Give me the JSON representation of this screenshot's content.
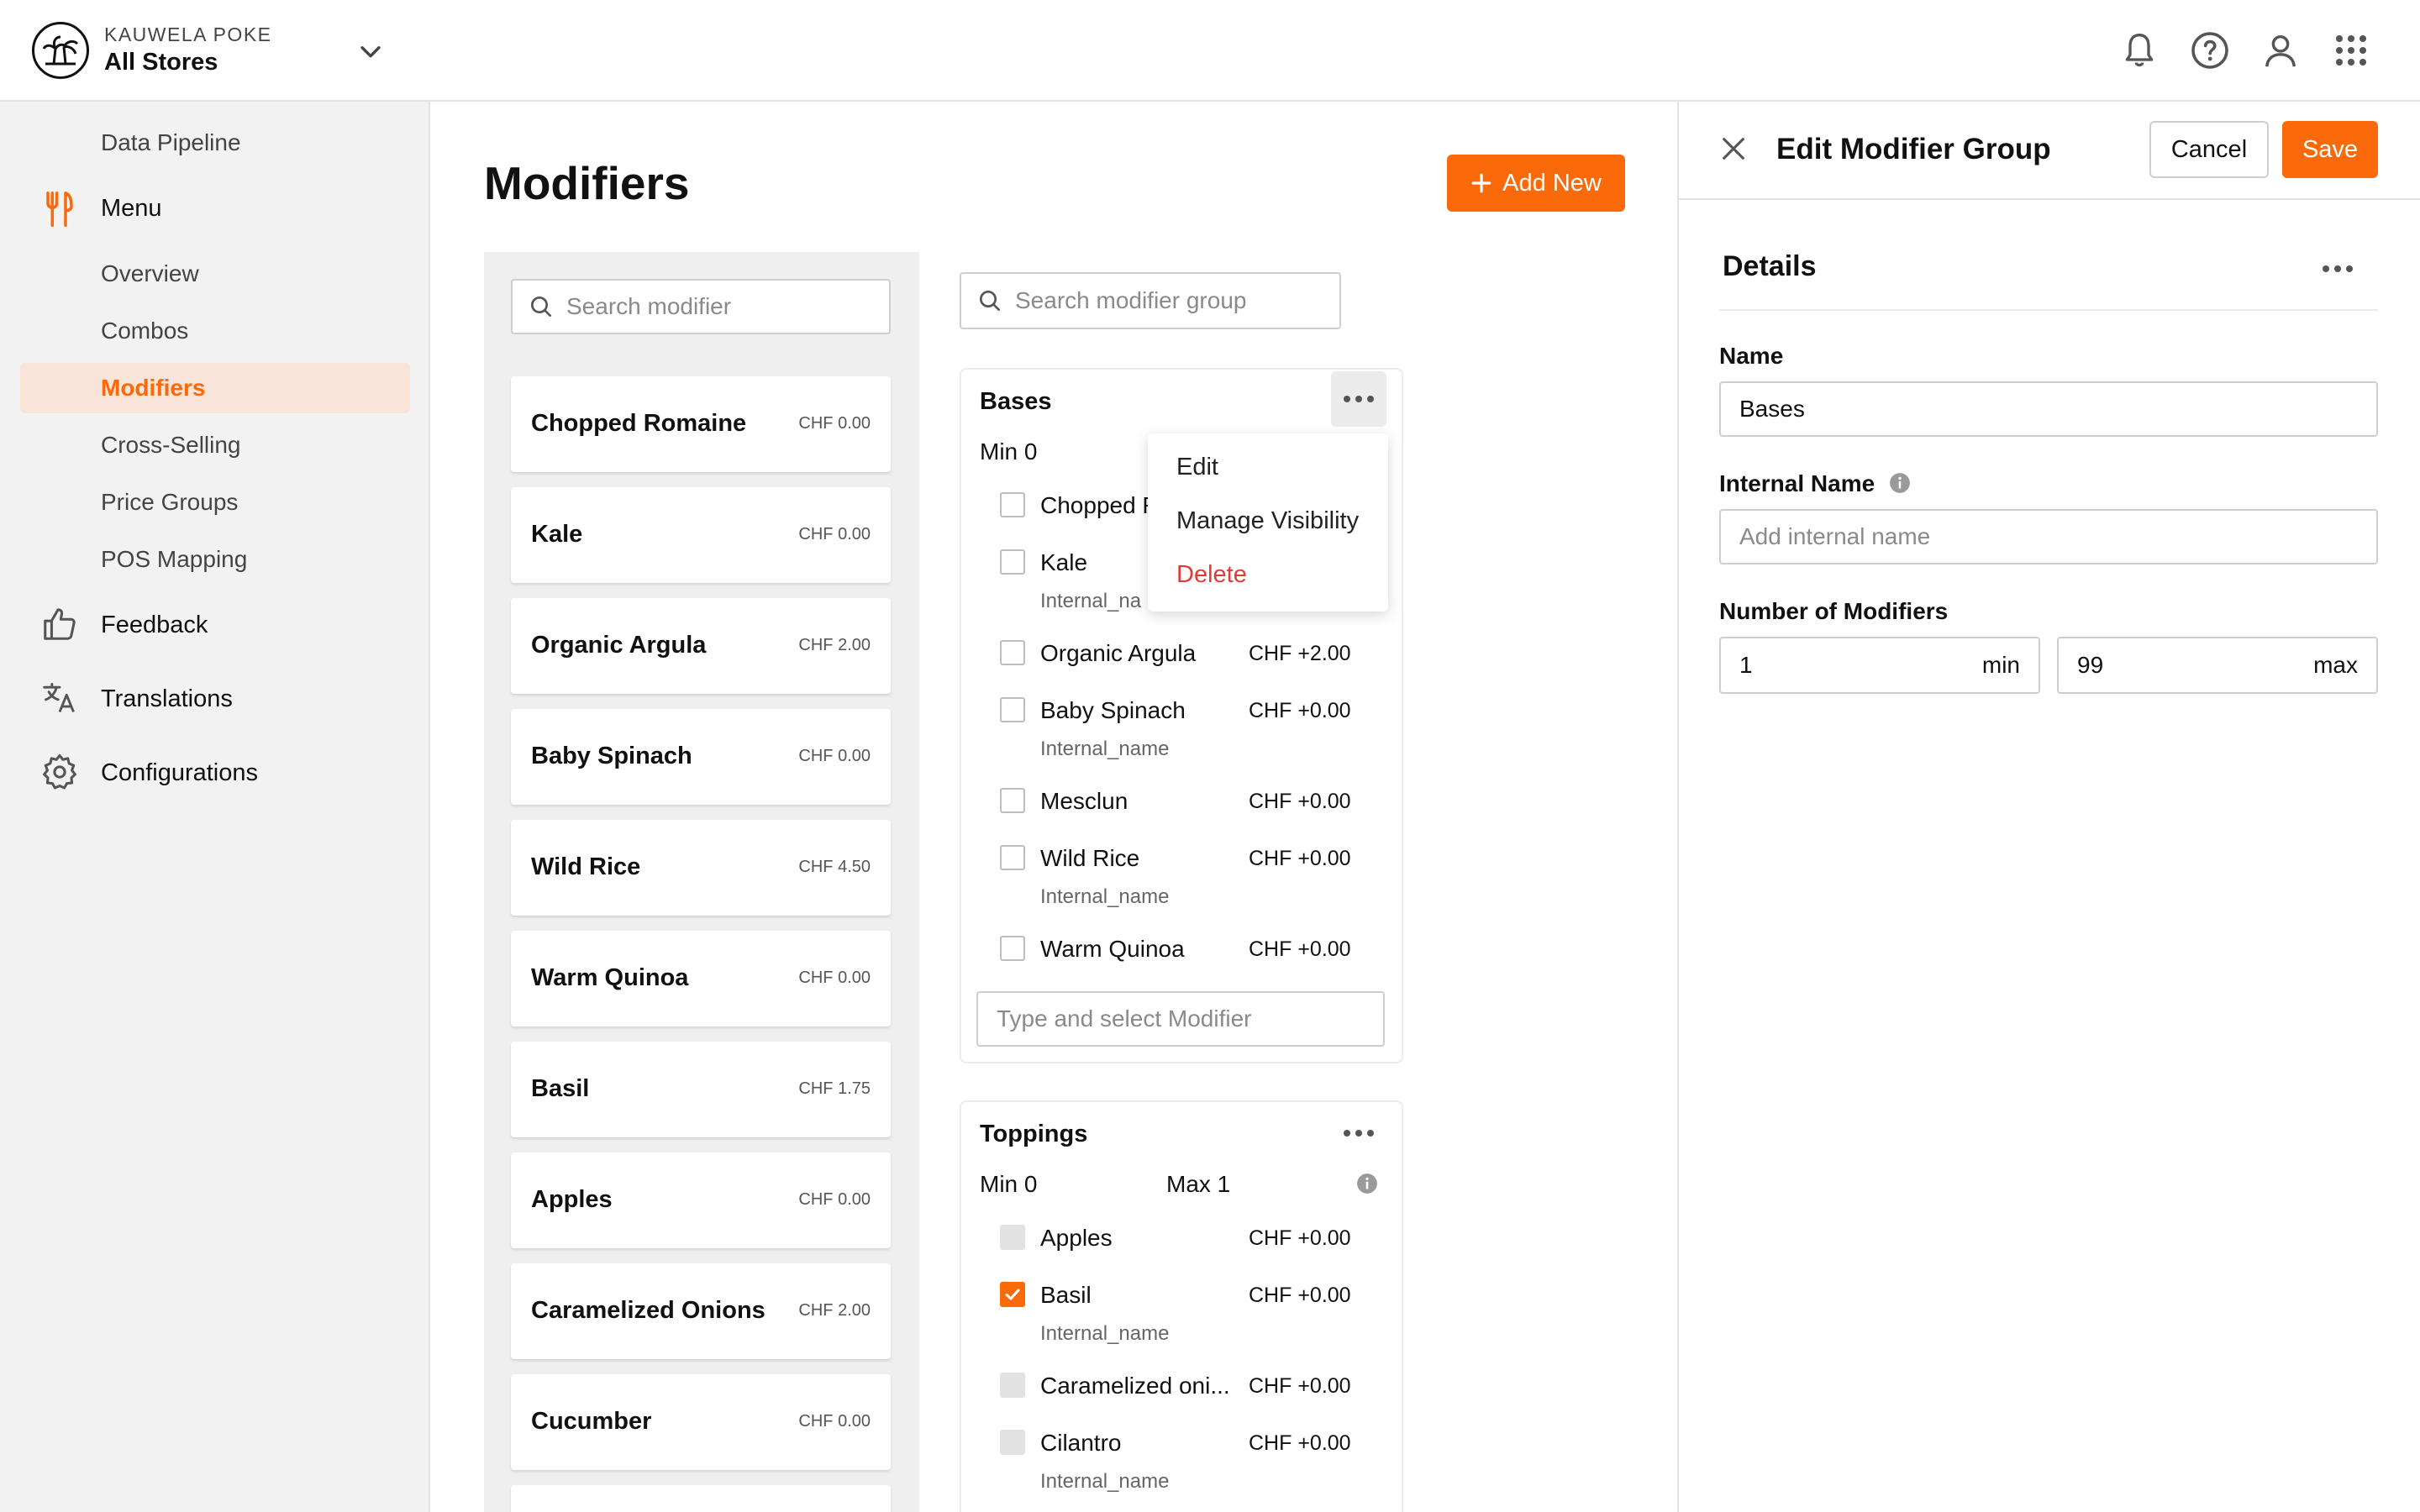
{
  "header": {
    "brand": "KAUWELA POKE",
    "store": "All Stores"
  },
  "sidebar": {
    "data_pipeline": "Data Pipeline",
    "menu": "Menu",
    "menu_items": [
      "Overview",
      "Combos",
      "Modifiers",
      "Cross-Selling",
      "Price Groups",
      "POS Mapping"
    ],
    "active_item": "Modifiers",
    "feedback": "Feedback",
    "translations": "Translations",
    "configurations": "Configurations"
  },
  "main": {
    "title": "Modifiers",
    "add_new": "Add New",
    "search_modifier_placeholder": "Search modifier",
    "search_group_placeholder": "Search modifier group",
    "modifiers": [
      {
        "name": "Chopped Romaine",
        "price": "CHF 0.00"
      },
      {
        "name": "Kale",
        "price": "CHF 0.00"
      },
      {
        "name": "Organic Argula",
        "price": "CHF 2.00"
      },
      {
        "name": "Baby Spinach",
        "price": "CHF 0.00"
      },
      {
        "name": "Wild Rice",
        "price": "CHF 4.50"
      },
      {
        "name": "Warm Quinoa",
        "price": "CHF 0.00"
      },
      {
        "name": "Basil",
        "price": "CHF 1.75"
      },
      {
        "name": "Apples",
        "price": "CHF 0.00"
      },
      {
        "name": "Caramelized Onions",
        "price": "CHF 2.00"
      },
      {
        "name": "Cucumber",
        "price": "CHF 0.00"
      }
    ],
    "groups": {
      "bases": {
        "title": "Bases",
        "min": "Min 0",
        "items": [
          {
            "name": "Chopped R",
            "price": "",
            "internal": ""
          },
          {
            "name": "Kale",
            "price": "",
            "internal": "Internal_na"
          },
          {
            "name": "Organic Argula",
            "price": "CHF +2.00",
            "internal": ""
          },
          {
            "name": "Baby Spinach",
            "price": "CHF +0.00",
            "internal": "Internal_name"
          },
          {
            "name": "Mesclun",
            "price": "CHF +0.00",
            "internal": ""
          },
          {
            "name": "Wild Rice",
            "price": "CHF +0.00",
            "internal": "Internal_name"
          },
          {
            "name": "Warm Quinoa",
            "price": "CHF +0.00",
            "internal": ""
          }
        ],
        "type_select_placeholder": "Type and select Modifier"
      },
      "toppings": {
        "title": "Toppings",
        "min": "Min 0",
        "max": "Max 1",
        "items": [
          {
            "name": "Apples",
            "price": "CHF +0.00",
            "internal": ""
          },
          {
            "name": "Basil",
            "price": "CHF +0.00",
            "internal": "Internal_name",
            "checked": true
          },
          {
            "name": "Caramelized oni...",
            "price": "CHF +0.00",
            "internal": ""
          },
          {
            "name": "Cilantro",
            "price": "CHF +0.00",
            "internal": "Internal_name"
          }
        ]
      }
    },
    "context_menu": {
      "edit": "Edit",
      "manage_visibility": "Manage Visibility",
      "delete": "Delete"
    }
  },
  "panel": {
    "title": "Edit Modifier Group",
    "cancel": "Cancel",
    "save": "Save",
    "section": "Details",
    "name_label": "Name",
    "name_value": "Bases",
    "internal_label": "Internal Name",
    "internal_placeholder": "Add internal name",
    "count_label": "Number of Modifiers",
    "min_value": "1",
    "min_suffix": "min",
    "max_value": "99",
    "max_suffix": "max"
  },
  "colors": {
    "accent": "#fa6a0a",
    "active_bg": "#f8e4d8",
    "danger": "#e53935"
  }
}
